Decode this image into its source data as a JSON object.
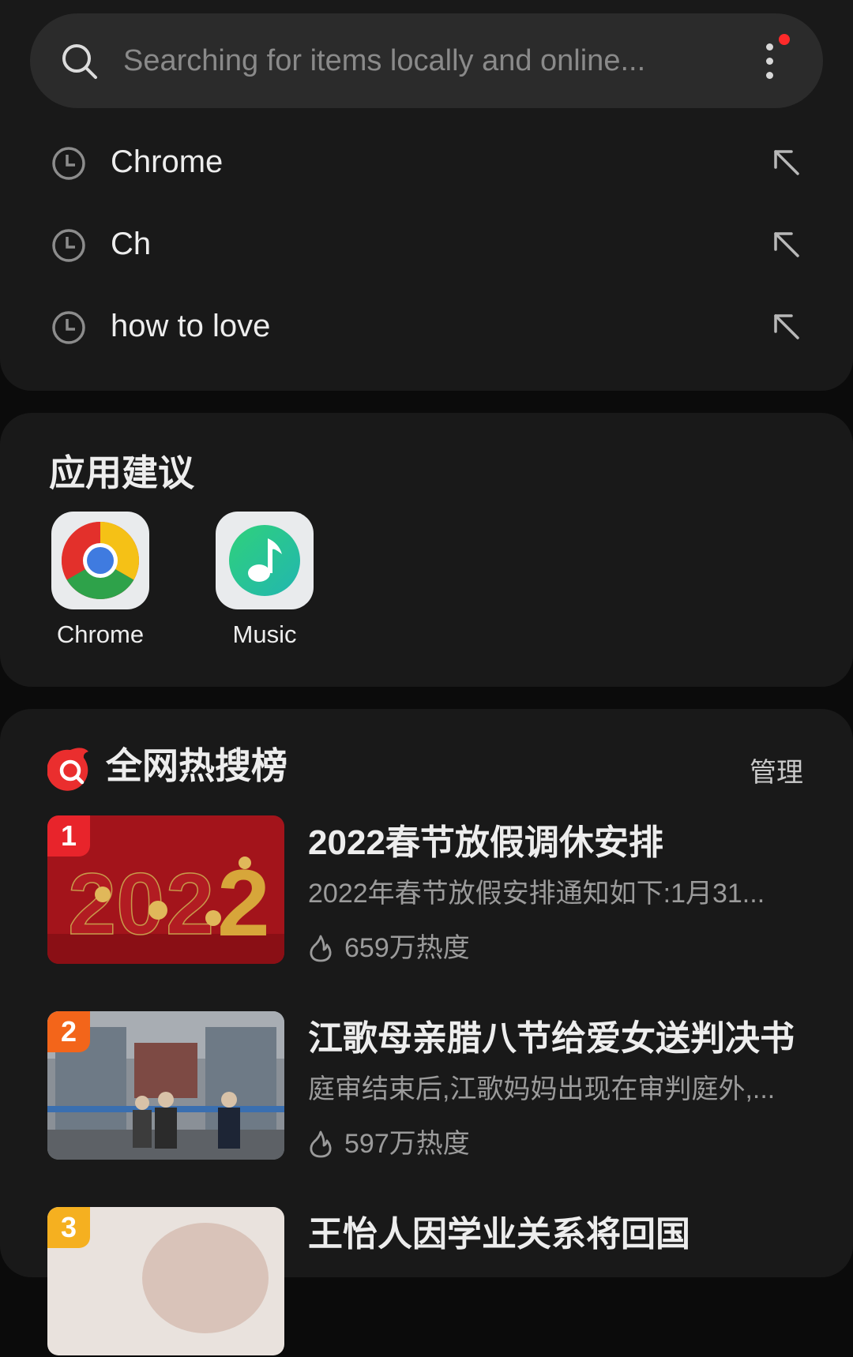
{
  "search": {
    "placeholder": "Searching for items locally and online..."
  },
  "history": [
    {
      "text": "Chrome"
    },
    {
      "text": "Ch"
    },
    {
      "text": "how to love"
    }
  ],
  "app_suggestions": {
    "title": "应用建议",
    "apps": [
      {
        "label": "Chrome",
        "icon": "chrome-icon"
      },
      {
        "label": "Music",
        "icon": "music-icon"
      }
    ]
  },
  "hot_search": {
    "title": "全网热搜榜",
    "manage_label": "管理",
    "items": [
      {
        "rank": "1",
        "title": "2022春节放假调休安排",
        "desc": "2022年春节放假安排通知如下:1月31...",
        "heat": "659万热度",
        "rank_color": "#e8242b"
      },
      {
        "rank": "2",
        "title": "江歌母亲腊八节给爱女送判决书",
        "desc": "庭审结束后,江歌妈妈出现在审判庭外,...",
        "heat": "597万热度",
        "rank_color": "#f3651a"
      },
      {
        "rank": "3",
        "title": "王怡人因学业关系将回国",
        "desc": "",
        "heat": "",
        "rank_color": "#f5b020"
      }
    ]
  },
  "colors": {
    "background": "#0b0b0b",
    "card": "#191919",
    "search_bar": "#2b2b2b",
    "notification_dot": "#ff2a2a"
  }
}
